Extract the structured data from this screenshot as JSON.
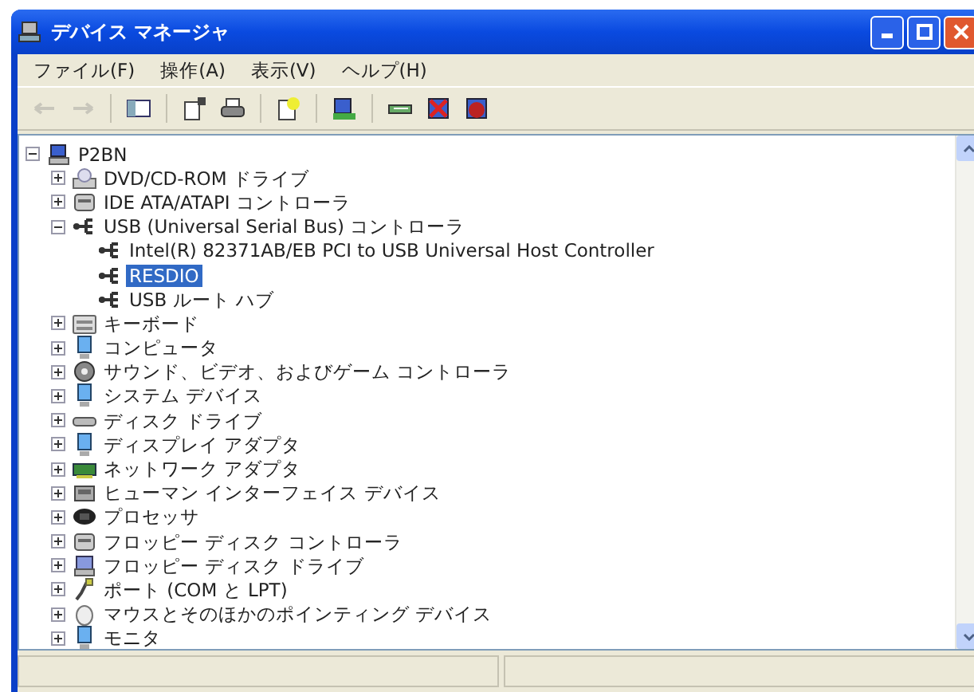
{
  "window": {
    "title": "デバイス マネージャ"
  },
  "menu": [
    "ファイル(F)",
    "操作(A)",
    "表示(V)",
    "ヘルプ(H)"
  ],
  "toolbar": [
    {
      "kind": "back",
      "disabled": true
    },
    {
      "kind": "forward",
      "disabled": true
    },
    {
      "kind": "separator"
    },
    {
      "kind": "console-tree",
      "disabled": false
    },
    {
      "kind": "separator"
    },
    {
      "kind": "properties",
      "disabled": false
    },
    {
      "kind": "print",
      "disabled": false
    },
    {
      "kind": "separator"
    },
    {
      "kind": "help",
      "disabled": false
    },
    {
      "kind": "separator"
    },
    {
      "kind": "scan",
      "disabled": false
    },
    {
      "kind": "separator"
    },
    {
      "kind": "update",
      "disabled": false
    },
    {
      "kind": "uninstall",
      "disabled": false
    },
    {
      "kind": "disable",
      "disabled": false
    }
  ],
  "tree": {
    "label": "P2BN",
    "kind": "computer",
    "expanded": true,
    "selected": false,
    "children": [
      {
        "label": "DVD/CD-ROM ドライブ",
        "kind": "cdrom",
        "expanded": false,
        "selected": false
      },
      {
        "label": "IDE ATA/ATAPI コントローラ",
        "kind": "ide",
        "expanded": false,
        "selected": false
      },
      {
        "label": "USB (Universal Serial Bus) コントローラ",
        "kind": "usb",
        "expanded": true,
        "selected": false,
        "children": [
          {
            "label": "Intel(R) 82371AB/EB PCI to USB Universal Host Controller",
            "kind": "usb",
            "selected": false
          },
          {
            "label": "RESDIO",
            "kind": "usb",
            "selected": true
          },
          {
            "label": "USB ルート ハブ",
            "kind": "usb",
            "selected": false
          }
        ]
      },
      {
        "label": "キーボード",
        "kind": "keyboard",
        "expanded": false,
        "selected": false
      },
      {
        "label": "コンピュータ",
        "kind": "monitor",
        "expanded": false,
        "selected": false
      },
      {
        "label": "サウンド、ビデオ、およびゲーム コントローラ",
        "kind": "sound",
        "expanded": false,
        "selected": false
      },
      {
        "label": "システム デバイス",
        "kind": "monitor",
        "expanded": false,
        "selected": false
      },
      {
        "label": "ディスク ドライブ",
        "kind": "disk",
        "expanded": false,
        "selected": false
      },
      {
        "label": "ディスプレイ アダプタ",
        "kind": "monitor",
        "expanded": false,
        "selected": false
      },
      {
        "label": "ネットワーク アダプタ",
        "kind": "network",
        "expanded": false,
        "selected": false
      },
      {
        "label": "ヒューマン インターフェイス デバイス",
        "kind": "hid",
        "expanded": false,
        "selected": false
      },
      {
        "label": "プロセッサ",
        "kind": "processor",
        "expanded": false,
        "selected": false
      },
      {
        "label": "フロッピー ディスク コントローラ",
        "kind": "ide",
        "expanded": false,
        "selected": false
      },
      {
        "label": "フロッピー ディスク ドライブ",
        "kind": "floppy",
        "expanded": false,
        "selected": false
      },
      {
        "label": "ポート (COM と LPT)",
        "kind": "port",
        "expanded": false,
        "selected": false
      },
      {
        "label": "マウスとそのほかのポインティング デバイス",
        "kind": "mouse",
        "expanded": false,
        "selected": false
      },
      {
        "label": "モニタ",
        "kind": "monitor",
        "expanded": false,
        "selected": false
      }
    ]
  }
}
